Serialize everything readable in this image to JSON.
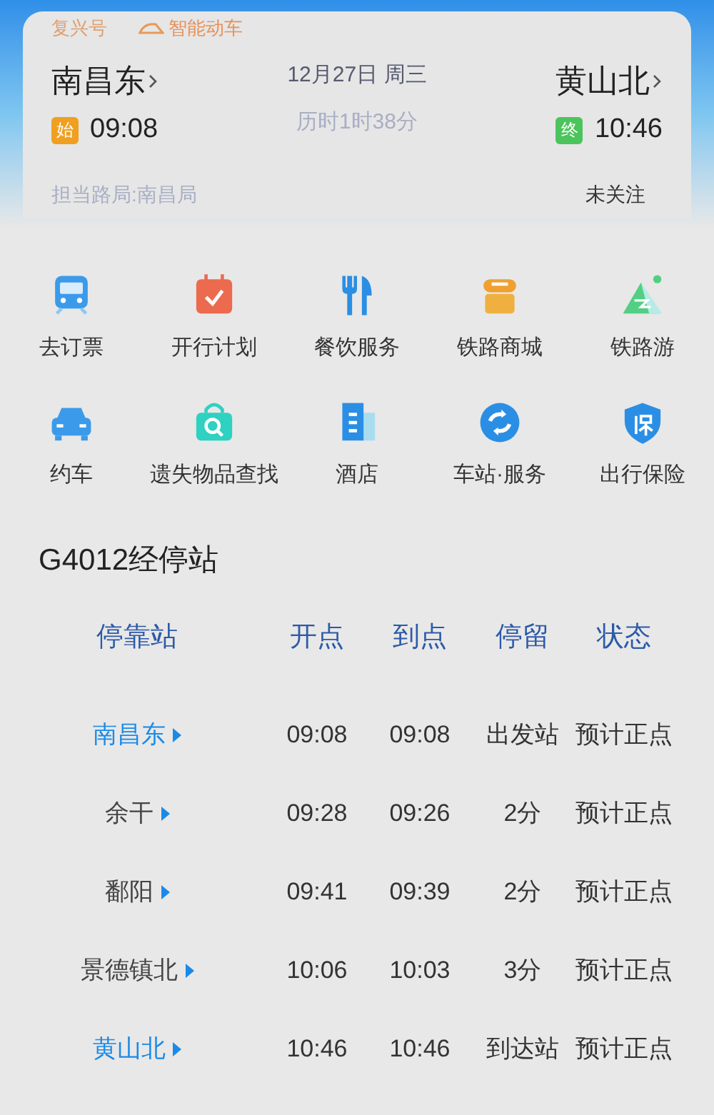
{
  "train_card": {
    "train_type": "复兴号",
    "feature": "智能动车",
    "from_station": "南昌东",
    "from_badge": "始",
    "from_time": "09:08",
    "date": "12月27日 周三",
    "duration": "历时1时38分",
    "to_station": "黄山北",
    "to_badge": "终",
    "to_time": "10:46",
    "bureau": "担当路局:南昌局",
    "follow": "未关注"
  },
  "services": [
    {
      "label": "去订票"
    },
    {
      "label": "开行计划"
    },
    {
      "label": "餐饮服务"
    },
    {
      "label": "铁路商城"
    },
    {
      "label": "铁路游"
    },
    {
      "label": "约车"
    },
    {
      "label": "遗失物品查找"
    },
    {
      "label": "酒店"
    },
    {
      "label": "车站·服务"
    },
    {
      "label": "出行保险"
    }
  ],
  "stops": {
    "title": "G4012经停站",
    "columns": [
      "停靠站",
      "开点",
      "到点",
      "停留",
      "状态"
    ],
    "rows": [
      {
        "station": "南昌东",
        "highlighted": true,
        "depart": "09:08",
        "arrive": "09:08",
        "stay": "出发站",
        "status": "预计正点"
      },
      {
        "station": "余干",
        "highlighted": false,
        "depart": "09:28",
        "arrive": "09:26",
        "stay": "2分",
        "status": "预计正点"
      },
      {
        "station": "鄱阳",
        "highlighted": false,
        "depart": "09:41",
        "arrive": "09:39",
        "stay": "2分",
        "status": "预计正点"
      },
      {
        "station": "景德镇北",
        "highlighted": false,
        "depart": "10:06",
        "arrive": "10:03",
        "stay": "3分",
        "status": "预计正点"
      },
      {
        "station": "黄山北",
        "highlighted": true,
        "depart": "10:46",
        "arrive": "10:46",
        "stay": "到达站",
        "status": "预计正点"
      }
    ]
  }
}
